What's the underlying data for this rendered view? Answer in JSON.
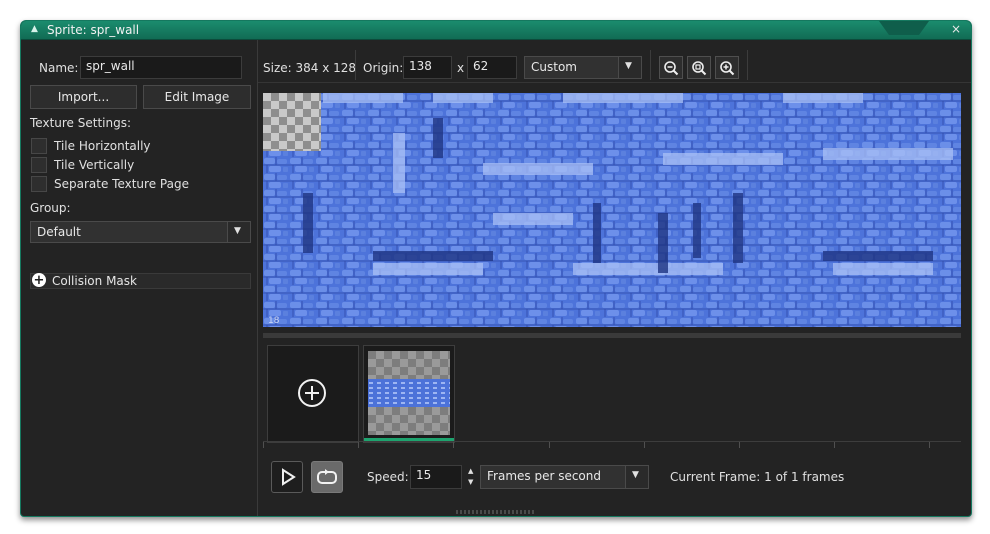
{
  "window": {
    "title": "Sprite: spr_wall",
    "close_glyph": "×"
  },
  "left_panel": {
    "name_label": "Name:",
    "name_value": "spr_wall",
    "import_button": "Import...",
    "edit_image_button": "Edit Image",
    "texture_settings_label": "Texture Settings:",
    "checkboxes": [
      {
        "label": "Tile Horizontally",
        "checked": false
      },
      {
        "label": "Tile Vertically",
        "checked": false
      },
      {
        "label": "Separate Texture Page",
        "checked": false
      }
    ],
    "group_label": "Group:",
    "group_value": "Default",
    "collision_mask_label": "Collision Mask"
  },
  "toolbar": {
    "size_text": "Size: 384 x 128",
    "origin_label": "Origin:",
    "origin_x": "138",
    "origin_separator": "x",
    "origin_y": "62",
    "origin_preset": "Custom",
    "zoom_buttons": [
      "zoom-out-icon",
      "zoom-reset-icon",
      "zoom-in-icon"
    ]
  },
  "canvas": {
    "corner_label": "18"
  },
  "playback": {
    "speed_label": "Speed:",
    "speed_value": "15",
    "speed_unit": "Frames per second",
    "current_frame_text": "Current Frame: 1 of 1 frames"
  },
  "colors": {
    "accent": "#1ea46f",
    "titlebar": "#137a5f",
    "panel": "#232323",
    "sprite_blue": "#4a6fd8"
  }
}
